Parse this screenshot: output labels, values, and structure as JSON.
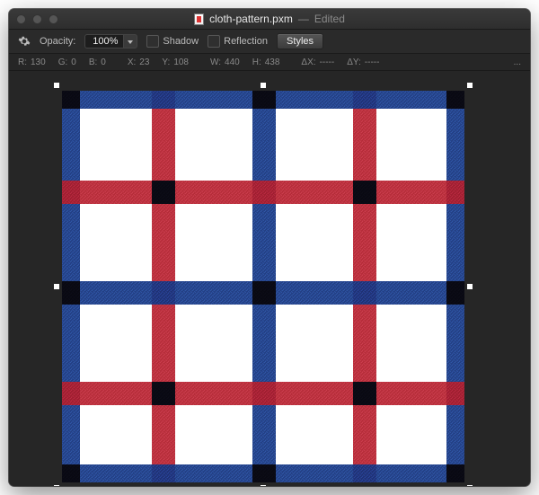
{
  "title": {
    "filename": "cloth-pattern.pxm",
    "status": "Edited",
    "sep": "—"
  },
  "options": {
    "opacity_label": "Opacity:",
    "opacity_value": "100%",
    "shadow_label": "Shadow",
    "reflection_label": "Reflection",
    "styles_label": "Styles"
  },
  "props": {
    "r_label": "R:",
    "r_val": "130",
    "g_label": "G:",
    "g_val": "0",
    "b_label": "B:",
    "b_val": "0",
    "x_label": "X:",
    "x_val": "23",
    "y_label": "Y:",
    "y_val": "108",
    "w_label": "W:",
    "w_val": "440",
    "h_label": "H:",
    "h_val": "438",
    "dx_label": "ΔX:",
    "dx_val": "-----",
    "dy_label": "ΔY:",
    "dy_val": "-----",
    "more": "..."
  }
}
